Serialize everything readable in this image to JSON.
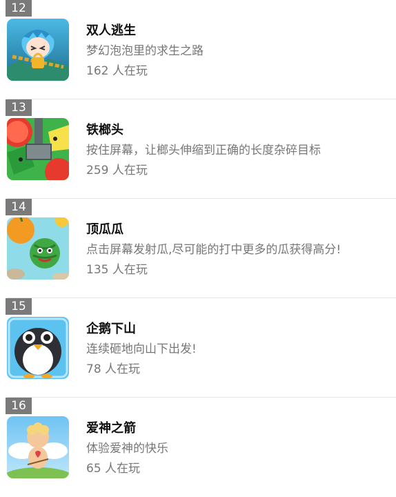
{
  "games": [
    {
      "rank": "12",
      "title": "双人逃生",
      "desc": "梦幻泡泡里的求生之路",
      "plays": "162 人在玩"
    },
    {
      "rank": "13",
      "title": "铁榔头",
      "desc": "按住屏幕，让榔头伸缩到正确的长度杂碎目标",
      "plays": "259 人在玩"
    },
    {
      "rank": "14",
      "title": "顶瓜瓜",
      "desc": "点击屏幕发射瓜,尽可能的打中更多的瓜获得高分!",
      "plays": "135 人在玩"
    },
    {
      "rank": "15",
      "title": "企鹅下山",
      "desc": "连续砸地向山下出发!",
      "plays": "78 人在玩"
    },
    {
      "rank": "16",
      "title": "爱神之箭",
      "desc": "体验爱神的快乐",
      "plays": "65 人在玩"
    }
  ]
}
